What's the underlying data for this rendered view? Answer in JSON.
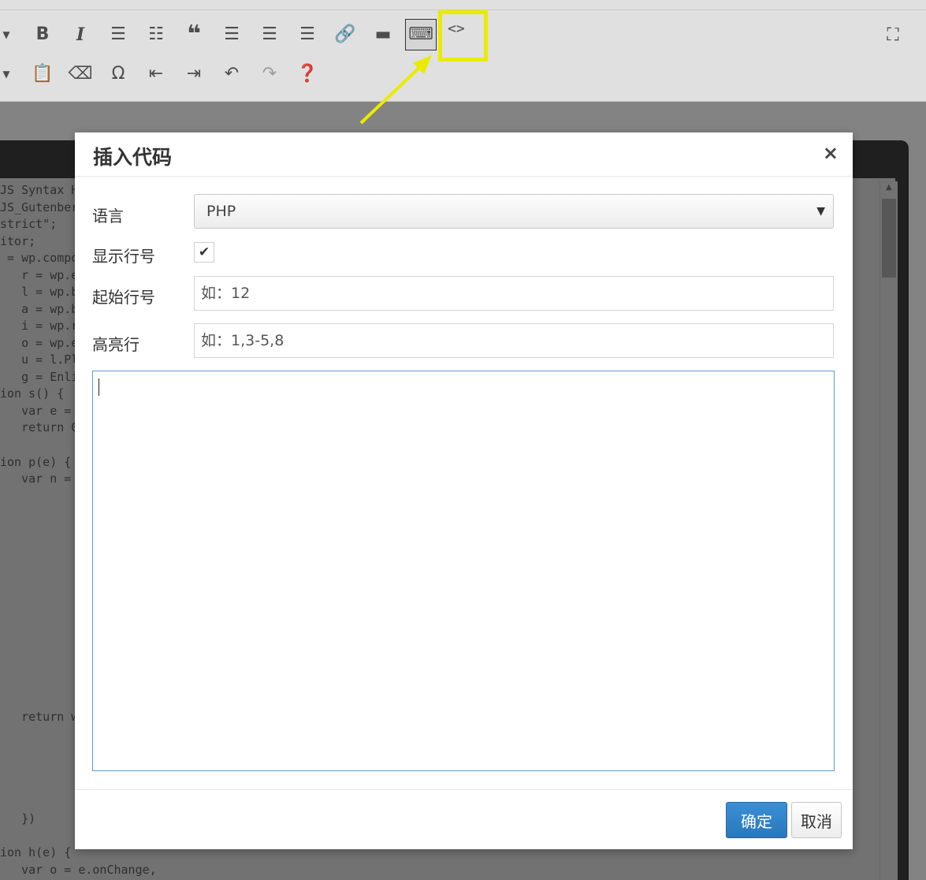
{
  "toolbar": {
    "row1": [
      {
        "icon": "dropdown-arrow",
        "glyph": "▼"
      },
      {
        "icon": "bold-icon",
        "glyph": "B"
      },
      {
        "icon": "italic-icon",
        "glyph": "I"
      },
      {
        "icon": "bullet-list-icon",
        "glyph": "☰"
      },
      {
        "icon": "numbered-list-icon",
        "glyph": "☷"
      },
      {
        "icon": "blockquote-icon",
        "glyph": "❝"
      },
      {
        "icon": "align-left-icon",
        "glyph": "☰"
      },
      {
        "icon": "align-center-icon",
        "glyph": "☰"
      },
      {
        "icon": "align-right-icon",
        "glyph": "☰"
      },
      {
        "icon": "link-icon",
        "glyph": "🔗"
      },
      {
        "icon": "read-more-icon",
        "glyph": "▬"
      },
      {
        "icon": "keyboard-toolbar-toggle-icon",
        "glyph": "⌨"
      }
    ],
    "row2": [
      {
        "icon": "dropdown-arrow",
        "glyph": "▼"
      },
      {
        "icon": "paste-text-icon",
        "glyph": "📋"
      },
      {
        "icon": "clear-formatting-icon",
        "glyph": "⌫"
      },
      {
        "icon": "special-character-icon",
        "glyph": "Ω"
      },
      {
        "icon": "outdent-icon",
        "glyph": "⇤"
      },
      {
        "icon": "indent-icon",
        "glyph": "⇥"
      },
      {
        "icon": "undo-icon",
        "glyph": "↶"
      },
      {
        "icon": "redo-icon",
        "glyph": "↷"
      },
      {
        "icon": "help-icon",
        "glyph": "❓"
      }
    ],
    "insert_code_glyph": "<>",
    "fullscreen_glyph": "⛶",
    "highlight_color": "#ffff00"
  },
  "code_lines": [
    "JS Syntax H",
    "JS_Gutenber",
    "strict\";",
    "itor;",
    " = wp.compo",
    "   r = wp.e",
    "   l = wp.b",
    "   a = wp.b",
    "   i = wp.r",
    "   o = wp.e",
    "   u = l.Pl",
    "   g = Enli",
    "ion s() {",
    "   var e =",
    "   return 0",
    "ion p(e) {",
    "   var n =",
    "   return w",
    "   })",
    "ion h(e) {",
    "   var o = e.onChange,"
  ],
  "modal": {
    "title": "插入代码",
    "close_glyph": "×",
    "language_label": "语言",
    "language_value": "PHP",
    "language_arrow": "▼",
    "show_line_numbers_label": "显示行号",
    "show_line_numbers_check": "✔",
    "start_line_label": "起始行号",
    "start_line_placeholder": "如：12",
    "highlight_label": "高亮行",
    "highlight_placeholder": "如：1,3-5,8",
    "ok_label": "确定",
    "cancel_label": "取消",
    "accent_color": "#2a77bb"
  }
}
